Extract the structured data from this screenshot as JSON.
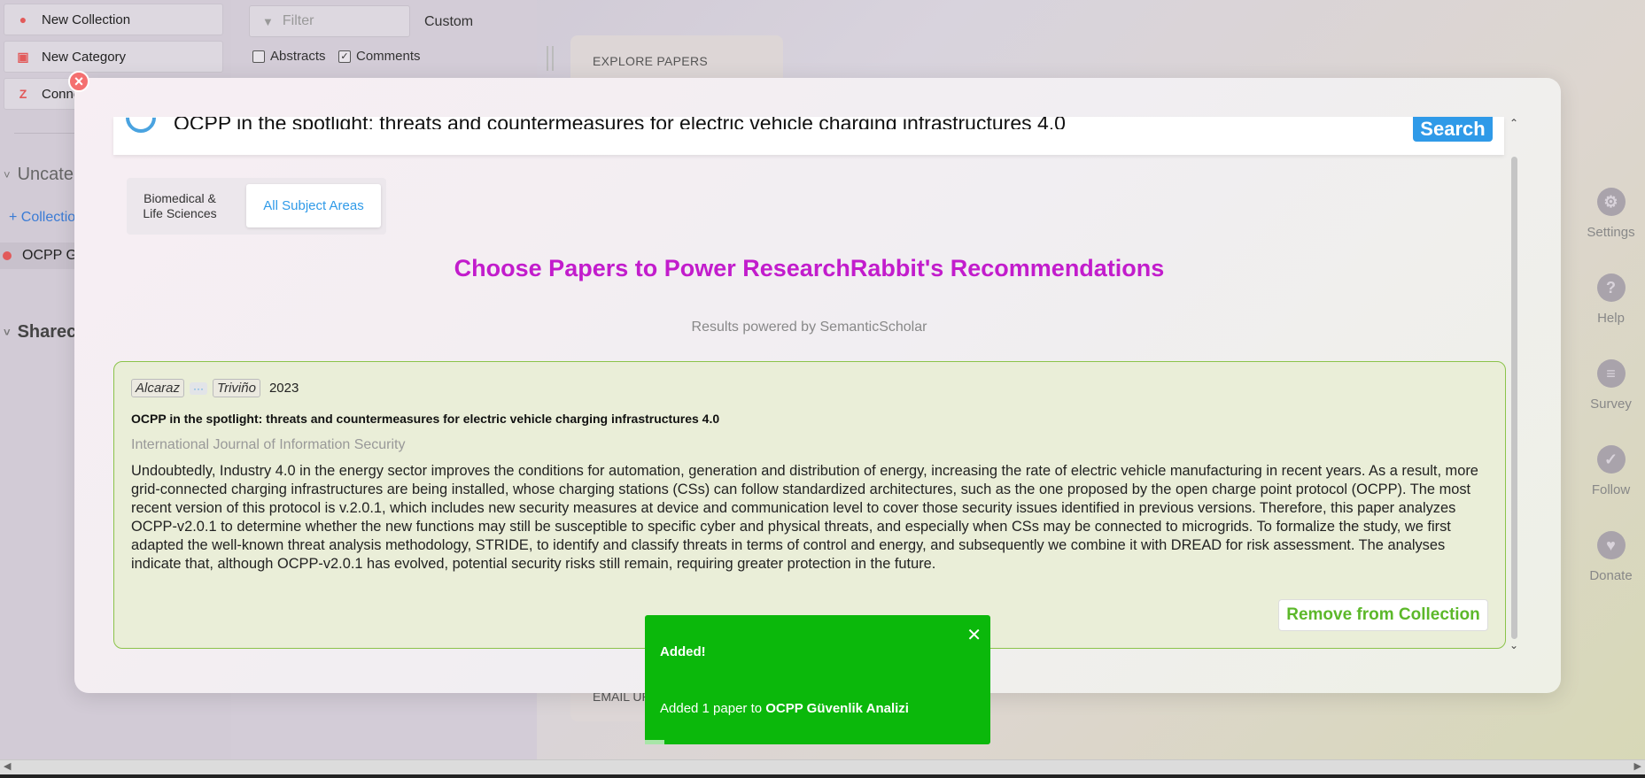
{
  "sidebar": {
    "new_collection": "New Collection",
    "new_category": "New Category",
    "connect": "Conne",
    "uncategorized": "Uncate",
    "add_collection": "+ Collectio",
    "collection_item": "OCPP G",
    "shared": "Sharec"
  },
  "toolbar": {
    "filter_placeholder": "Filter",
    "custom": "Custom",
    "abstracts_label": "Abstracts",
    "comments_label": "Comments"
  },
  "explore": {
    "title": "EXPLORE PAPERS",
    "email_label": "EMAIL UP"
  },
  "right_nav": [
    {
      "label": "Settings",
      "icon": "gear-icon"
    },
    {
      "label": "Help",
      "icon": "question-icon"
    },
    {
      "label": "Survey",
      "icon": "chat-icon"
    },
    {
      "label": "Follow",
      "icon": "twitter-icon"
    },
    {
      "label": "Donate",
      "icon": "heart-icon"
    }
  ],
  "modal": {
    "search_query": "OCPP in the spotlight: threats and countermeasures for electric vehicle charging infrastructures 4.0",
    "search_button": "Search",
    "tab_biomedical": "Biomedical & Life Sciences",
    "tab_all": "All Subject Areas",
    "headline": "Choose Papers to Power ResearchRabbit's Recommendations",
    "powered_by": "Results powered by SemanticScholar",
    "paper": {
      "author_first": "Alcaraz",
      "author_more": "···",
      "author_last": "Triviño",
      "year": "2023",
      "title": "OCPP in the spotlight: threats and countermeasures for electric vehicle charging infrastructures 4.0",
      "journal": "International Journal of Information Security",
      "abstract": "Undoubtedly, Industry 4.0 in the energy sector improves the conditions for automation, generation and distribution of energy, increasing the rate of electric vehicle manufacturing in recent years. As a result, more grid-connected charging infrastructures are being installed, whose charging stations (CSs) can follow standardized architectures, such as the one proposed by the open charge point protocol (OCPP). The most recent version of this protocol is v.2.0.1, which includes new security measures at device and communication level to cover those security issues identified in previous versions. Therefore, this paper analyzes OCPP-v2.0.1 to determine whether the new functions may still be susceptible to specific cyber and physical threats, and especially when CSs may be connected to microgrids. To formalize the study, we first adapted the well-known threat analysis methodology, STRIDE, to identify and classify threats in terms of control and energy, and subsequently we combine it with DREAD for risk assessment. The analyses indicate that, although OCPP-v2.0.1 has evolved, potential security risks still remain, requiring greater protection in the future.",
      "remove_button": "Remove from Collection"
    }
  },
  "toast": {
    "title": "Added!",
    "message_prefix": "Added 1 paper to ",
    "collection_name": "OCPP Güvenlik Analizi",
    "color": "#0bb80b"
  },
  "colors": {
    "accent": "#2f9ae8",
    "headline": "#c21ccc",
    "remove": "#5cb82a",
    "close": "#f47070"
  }
}
